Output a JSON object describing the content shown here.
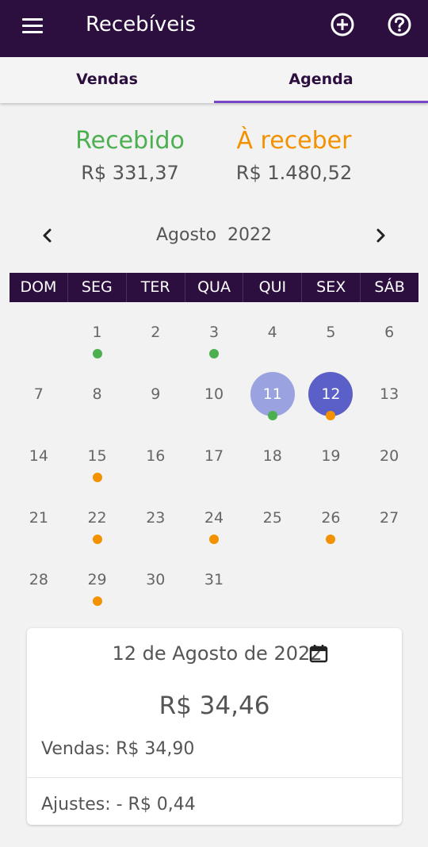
{
  "appbar": {
    "title": "Recebíveis",
    "menu_icon": "hamburger-menu-icon",
    "add_icon": "plus-circle-icon",
    "help_icon": "question-circle-icon",
    "background": "#2c0f3f"
  },
  "tabs": [
    {
      "label": "Vendas",
      "active": false
    },
    {
      "label": "Agenda",
      "active": true
    }
  ],
  "summary": {
    "received_label": "Recebido",
    "received_value": "R$ 331,37",
    "received_color": "#4caf50",
    "pending_label": "À receber",
    "pending_value": "R$ 1.480,52",
    "pending_color": "#f39200"
  },
  "calendar": {
    "month_label": "Agosto  2022",
    "weekdays": [
      "DOM",
      "SEG",
      "TER",
      "QUA",
      "QUI",
      "SEX",
      "SÁB"
    ],
    "weeks": [
      [
        {
          "day": ""
        },
        {
          "day": "1",
          "dot": "green"
        },
        {
          "day": "2"
        },
        {
          "day": "3",
          "dot": "green"
        },
        {
          "day": "4"
        },
        {
          "day": "5"
        },
        {
          "day": "6"
        }
      ],
      [
        {
          "day": "7"
        },
        {
          "day": "8"
        },
        {
          "day": "9"
        },
        {
          "day": "10"
        },
        {
          "day": "11",
          "dot": "green",
          "highlight": "light"
        },
        {
          "day": "12",
          "dot": "orange",
          "highlight": "dark"
        },
        {
          "day": "13"
        }
      ],
      [
        {
          "day": "14"
        },
        {
          "day": "15",
          "dot": "orange"
        },
        {
          "day": "16"
        },
        {
          "day": "17"
        },
        {
          "day": "18"
        },
        {
          "day": "19"
        },
        {
          "day": "20"
        }
      ],
      [
        {
          "day": "21"
        },
        {
          "day": "22",
          "dot": "orange"
        },
        {
          "day": "23"
        },
        {
          "day": "24",
          "dot": "orange"
        },
        {
          "day": "25"
        },
        {
          "day": "26",
          "dot": "orange"
        },
        {
          "day": "27"
        }
      ],
      [
        {
          "day": "28"
        },
        {
          "day": "29",
          "dot": "orange"
        },
        {
          "day": "30"
        },
        {
          "day": "31"
        },
        {
          "day": ""
        },
        {
          "day": ""
        },
        {
          "day": ""
        }
      ]
    ],
    "dot_colors": {
      "green": "#4caf50",
      "orange": "#f39200"
    },
    "highlight_colors": {
      "light": "#9aa2e0",
      "dark": "#5a60c8"
    }
  },
  "detail": {
    "date": "12 de Agosto de 2022",
    "calendar_icon": "calendar-icon",
    "total": "R$ 34,46",
    "sales": "Vendas: R$ 34,90",
    "adjustments": "Ajustes: - R$ 0,44"
  }
}
